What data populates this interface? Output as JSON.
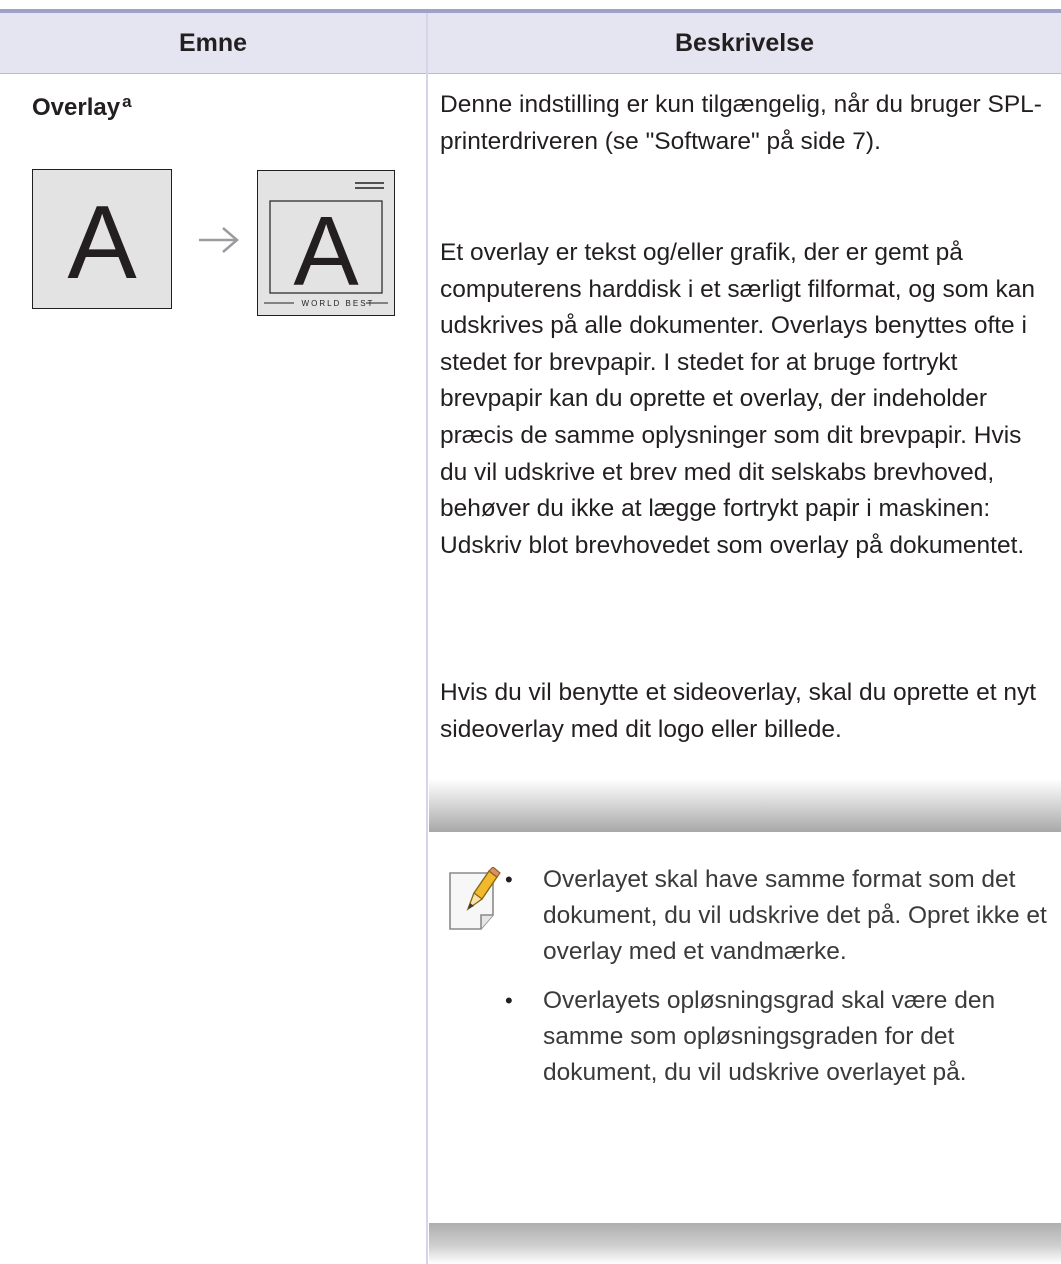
{
  "table": {
    "headers": [
      "Emne",
      "Beskrivelse"
    ]
  },
  "row": {
    "topic": "Overlay",
    "topic_footnote": "a",
    "illustration": {
      "before_letter": "A",
      "after_letter": "A",
      "after_footer_text": "WORLD BEST"
    },
    "paragraphs": [
      "Denne indstilling er kun tilgængelig, når du bruger SPL-printerdriveren (se \"Software\" på side 7).",
      "Et overlay er tekst og/eller grafik, der er gemt på computerens harddisk i et særligt filformat, og som kan udskrives på alle dokumenter. Overlays benyttes ofte i stedet for brevpapir. I stedet for at bruge fortrykt brevpapir kan du oprette et overlay, der indeholder præcis de samme oplysninger som dit brevpapir. Hvis du vil udskrive et brev med dit selskabs brevhoved, behøver du ikke at lægge fortrykt papir i maskinen: Udskriv blot brevhovedet som overlay på dokumentet.",
      "Hvis du vil benytte et sideoverlay, skal du oprette et nyt sideoverlay med dit logo eller billede."
    ],
    "note": {
      "icon": "note-pencil-icon",
      "bullets": [
        "Overlayet skal have samme format som det dokument, du vil udskrive det på. Opret ikke et overlay med et vandmærke.",
        "Overlayets opløsningsgrad skal være den samme som opløsningsgraden for det dokument, du vil udskrive overlayet på."
      ]
    }
  },
  "colors": {
    "header_bg": "#e4e5f0",
    "header_rule": "#9fa1c8",
    "text": "#231f20"
  }
}
